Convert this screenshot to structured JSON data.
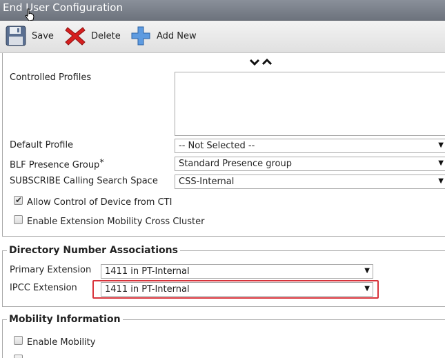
{
  "window": {
    "title": "End User Configuration"
  },
  "toolbar": {
    "save_label": "Save",
    "delete_label": "Delete",
    "add_new_label": "Add New"
  },
  "profile_section": {
    "controlled_profiles_label": "Controlled Profiles",
    "default_profile_label": "Default Profile",
    "default_profile_value": "-- Not Selected --",
    "blf_presence_group_label": "BLF Presence Group",
    "blf_required_mark": "*",
    "blf_presence_group_value": "Standard Presence group",
    "subscribe_css_label": "SUBSCRIBE Calling Search Space",
    "subscribe_css_value": "CSS-Internal",
    "allow_cti_label": "Allow Control of Device from CTI",
    "allow_cti_checked": true,
    "enable_em_cross_cluster_label": "Enable Extension Mobility Cross Cluster",
    "enable_em_cross_cluster_checked": false
  },
  "directory_numbers": {
    "legend": "Directory Number Associations",
    "primary_extension_label": "Primary Extension",
    "primary_extension_value": "1411 in PT-Internal",
    "ipcc_extension_label": "IPCC Extension",
    "ipcc_extension_value": "1411 in PT-Internal"
  },
  "mobility": {
    "legend": "Mobility Information",
    "enable_mobility_label": "Enable Mobility",
    "enable_mobility_checked": false
  },
  "icons": {
    "save": "floppy-disk-icon",
    "delete": "red-x-icon",
    "add_new": "blue-plus-icon",
    "collapse": "chevron-down-up-icon",
    "dropdown": "triangle-down-icon",
    "cursor": "hand-pointer-icon"
  },
  "colors": {
    "title_bar": "#7a808a",
    "highlight_border": "#d8323a",
    "delete_icon": "#d61f1f",
    "add_icon": "#3b7fd0"
  }
}
